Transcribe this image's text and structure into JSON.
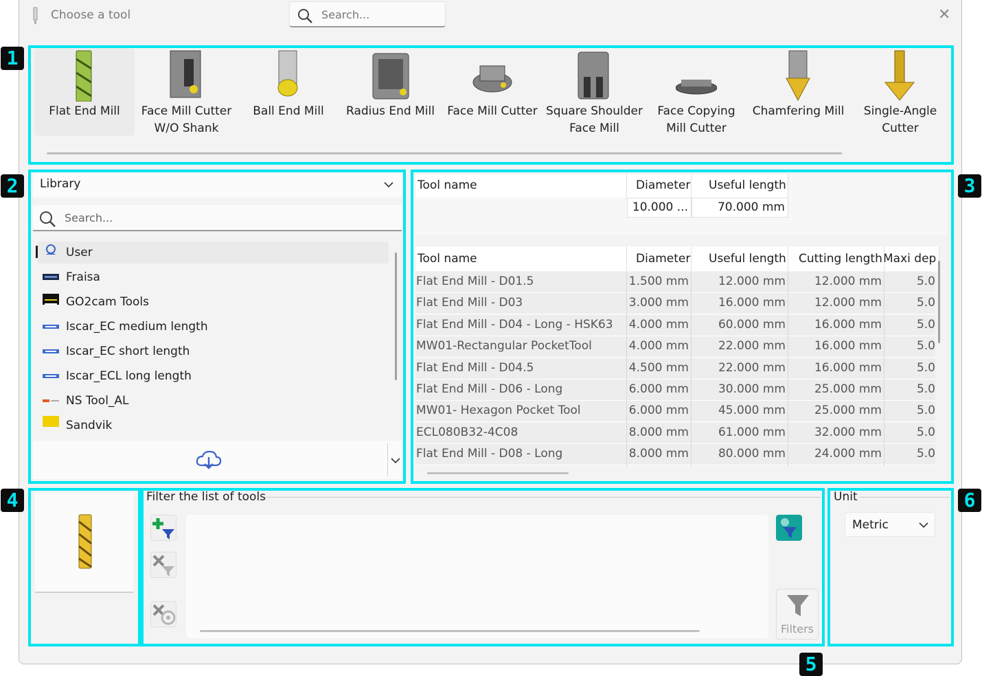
{
  "window": {
    "title": "Choose a tool",
    "search_placeholder": "Search...",
    "close_glyph": "✕"
  },
  "badges": [
    "1",
    "2",
    "3",
    "4",
    "5",
    "6"
  ],
  "tools": [
    {
      "label": "Flat End Mill",
      "icon": "flat-end-mill-icon",
      "selected": true
    },
    {
      "label": "Face Mill Cutter\nW/O Shank",
      "icon": "face-mill-cutter-wo-shank-icon",
      "selected": false
    },
    {
      "label": "Ball End Mill",
      "icon": "ball-end-mill-icon",
      "selected": false
    },
    {
      "label": "Radius End Mill",
      "icon": "radius-end-mill-icon",
      "selected": false
    },
    {
      "label": "Face Mill Cutter",
      "icon": "face-mill-cutter-icon",
      "selected": false
    },
    {
      "label": "Square Shoulder\nFace Mill",
      "icon": "square-shoulder-face-mill-icon",
      "selected": false
    },
    {
      "label": "Face Copying\nMill Cutter",
      "icon": "face-copying-mill-cutter-icon",
      "selected": false
    },
    {
      "label": "Chamfering Mill",
      "icon": "chamfering-mill-icon",
      "selected": false
    },
    {
      "label": "Single-Angle\nCutter",
      "icon": "single-angle-cutter-icon",
      "selected": false
    }
  ],
  "library": {
    "dropdown_label": "Library",
    "search_placeholder": "Search...",
    "items": [
      {
        "label": "User",
        "icon": "user-icon",
        "selected": true
      },
      {
        "label": "Fraisa",
        "icon": "fraisa-logo-icon",
        "selected": false
      },
      {
        "label": "GO2cam Tools",
        "icon": "go2cam-logo-icon",
        "selected": false
      },
      {
        "label": "Iscar_EC medium length",
        "icon": "iscar-logo-icon",
        "selected": false
      },
      {
        "label": "Iscar_EC short length",
        "icon": "iscar-logo-icon",
        "selected": false
      },
      {
        "label": "Iscar_ECL long length",
        "icon": "iscar-logo-icon",
        "selected": false
      },
      {
        "label": "NS Tool_AL",
        "icon": "ns-tool-logo-icon",
        "selected": false
      },
      {
        "label": "Sandvik",
        "icon": "sandvik-logo-icon",
        "selected": false
      }
    ]
  },
  "table": {
    "filter_row": {
      "headers": [
        "Tool name",
        "Diameter",
        "Useful length"
      ],
      "values": [
        "",
        "10.000 ...",
        "70.000 mm"
      ]
    },
    "headers": [
      "Tool name",
      "Diameter",
      "Useful length",
      "Cutting length",
      "Maxi dep"
    ],
    "sort_glyph": "^",
    "rows": [
      [
        "Flat End Mill - D01.5",
        "1.500 mm",
        "12.000 mm",
        "12.000 mm",
        "5.0"
      ],
      [
        "Flat End Mill - D03",
        "3.000 mm",
        "16.000 mm",
        "12.000 mm",
        "5.0"
      ],
      [
        "Flat End Mill - D04 - Long - HSK63",
        "4.000 mm",
        "60.000 mm",
        "16.000 mm",
        "5.0"
      ],
      [
        "MW01-Rectangular PocketTool",
        "4.000 mm",
        "22.000 mm",
        "16.000 mm",
        "5.0"
      ],
      [
        "Flat End Mill - D04.5",
        "4.500 mm",
        "22.000 mm",
        "16.000 mm",
        "5.0"
      ],
      [
        "Flat End Mill - D06 - Long",
        "6.000 mm",
        "30.000 mm",
        "25.000 mm",
        "5.0"
      ],
      [
        "MW01- Hexagon Pocket Tool",
        "6.000 mm",
        "45.000 mm",
        "25.000 mm",
        "5.0"
      ],
      [
        "ECL080B32-4C08",
        "8.000 mm",
        "61.000 mm",
        "32.000 mm",
        "5.0"
      ],
      [
        "Flat End Mill - D08 - Long",
        "8.000 mm",
        "80.000 mm",
        "24.000 mm",
        "5.0"
      ]
    ]
  },
  "filter": {
    "title": "Filter the list of tools",
    "filters_button": "Filters"
  },
  "unit": {
    "title": "Unit",
    "value": "Metric"
  },
  "colors": {
    "highlight": "#00e5ef",
    "badge_bg": "#0d0d0d"
  }
}
